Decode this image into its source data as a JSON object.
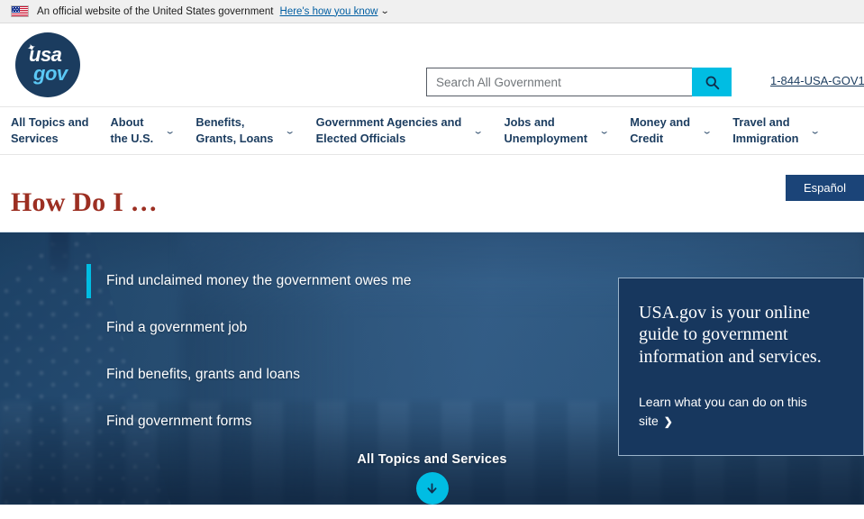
{
  "banner": {
    "flag_icon": "us-flag-icon",
    "text": "An official website of the United States government",
    "link_label": "Here's how you know",
    "chevron": "⌄"
  },
  "header": {
    "logo": {
      "star": "✦",
      "usa": "usa",
      "gov": "gov"
    },
    "search": {
      "placeholder": "Search All Government",
      "value": "",
      "button_icon": "search-icon"
    },
    "phone": "1-844-USA-GOV1"
  },
  "nav": {
    "items": [
      {
        "label": "All Topics and\nServices",
        "has_dropdown": false
      },
      {
        "label": "About\nthe U.S.",
        "has_dropdown": true
      },
      {
        "label": "Benefits,\nGrants, Loans",
        "has_dropdown": true
      },
      {
        "label": "Government Agencies and\nElected Officials",
        "has_dropdown": true
      },
      {
        "label": "Jobs and\nUnemployment",
        "has_dropdown": true
      },
      {
        "label": "Money and\nCredit",
        "has_dropdown": true
      },
      {
        "label": "Travel and\nImmigration",
        "has_dropdown": true
      }
    ],
    "chevron": "⌄"
  },
  "title_strip": {
    "espanol_label": "Español",
    "page_title": "How Do I …"
  },
  "hero": {
    "how_do_i_items": [
      {
        "label": "Find unclaimed money the government owes me",
        "active": true
      },
      {
        "label": "Find a government job",
        "active": false
      },
      {
        "label": "Find benefits, grants and loans",
        "active": false
      },
      {
        "label": "Find government forms",
        "active": false
      }
    ],
    "info_card": {
      "heading": "USA.gov is your online guide to government information and services.",
      "link_label": "Learn what you can do on this site",
      "link_chevron": "❯"
    },
    "all_topics": {
      "label": "All Topics and Services",
      "button_icon": "arrow-down-icon"
    }
  },
  "colors": {
    "accent_cyan": "#00bde3",
    "navy": "#1b3c5f",
    "espanol_navy": "#1b4478",
    "title_red": "#9c2f22",
    "card_navy": "#17375e",
    "banner_gray": "#f0f0f0"
  }
}
